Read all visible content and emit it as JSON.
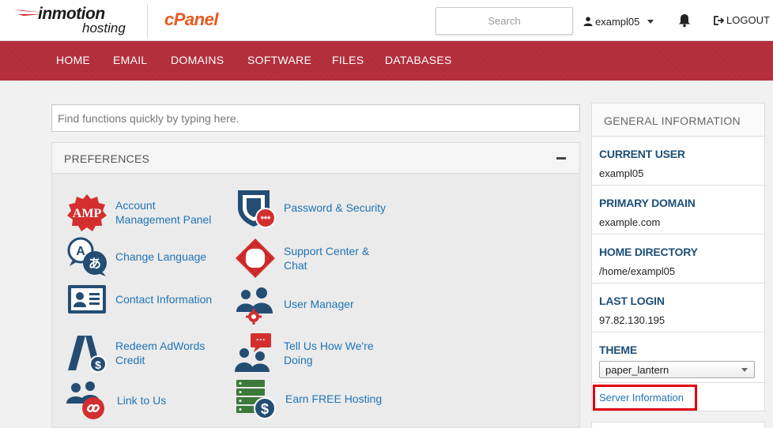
{
  "header": {
    "brand_line1": "inmotion",
    "brand_line2": "hosting",
    "product": "cPanel",
    "search_placeholder": "Search",
    "user": "exampl05",
    "logout": "LOGOUT"
  },
  "nav": [
    "HOME",
    "EMAIL",
    "DOMAINS",
    "SOFTWARE",
    "FILES",
    "DATABASES"
  ],
  "function_search": {
    "placeholder": "Find functions quickly by typing here."
  },
  "preferences": {
    "title": "PREFERENCES",
    "items": [
      {
        "label": "Account Management Panel",
        "icon": "amp-badge-icon",
        "icon_text": "AMP"
      },
      {
        "label": "Password & Security",
        "icon": "shield-lock-icon",
        "icon_text": "***"
      },
      {
        "label": "Change Language",
        "icon": "language-icon",
        "icon_text": "A",
        "icon_text2": "あ"
      },
      {
        "label": "Support Center & Chat",
        "icon": "lifebuoy-icon"
      },
      {
        "label": "Contact Information",
        "icon": "contact-card-icon"
      },
      {
        "label": "User Manager",
        "icon": "users-gear-icon"
      },
      {
        "label": "Redeem AdWords Credit",
        "icon": "adwords-icon"
      },
      {
        "label": "Tell Us How We're Doing",
        "icon": "feedback-icon",
        "icon_text": "···"
      },
      {
        "label": "Link to Us",
        "icon": "link-user-icon"
      },
      {
        "label": "Earn FREE Hosting",
        "icon": "server-dollar-icon"
      }
    ]
  },
  "general_info": {
    "title": "GENERAL INFORMATION",
    "current_user": {
      "label": "CURRENT USER",
      "value": "exampl05"
    },
    "primary_domain": {
      "label": "PRIMARY DOMAIN",
      "value": "example.com"
    },
    "home_directory": {
      "label": "HOME DIRECTORY",
      "value": "/home/exampl05"
    },
    "last_login": {
      "label": "LAST LOGIN",
      "value": "97.82.130.195"
    },
    "theme": {
      "label": "THEME",
      "value": "paper_lantern"
    },
    "server_info_link": "Server Information"
  },
  "colors": {
    "nav_bg": "#b6303c",
    "link": "#1f74b5",
    "label": "#1d4f75",
    "cpanel": "#e85a1f",
    "highlight": "#e0000d"
  }
}
